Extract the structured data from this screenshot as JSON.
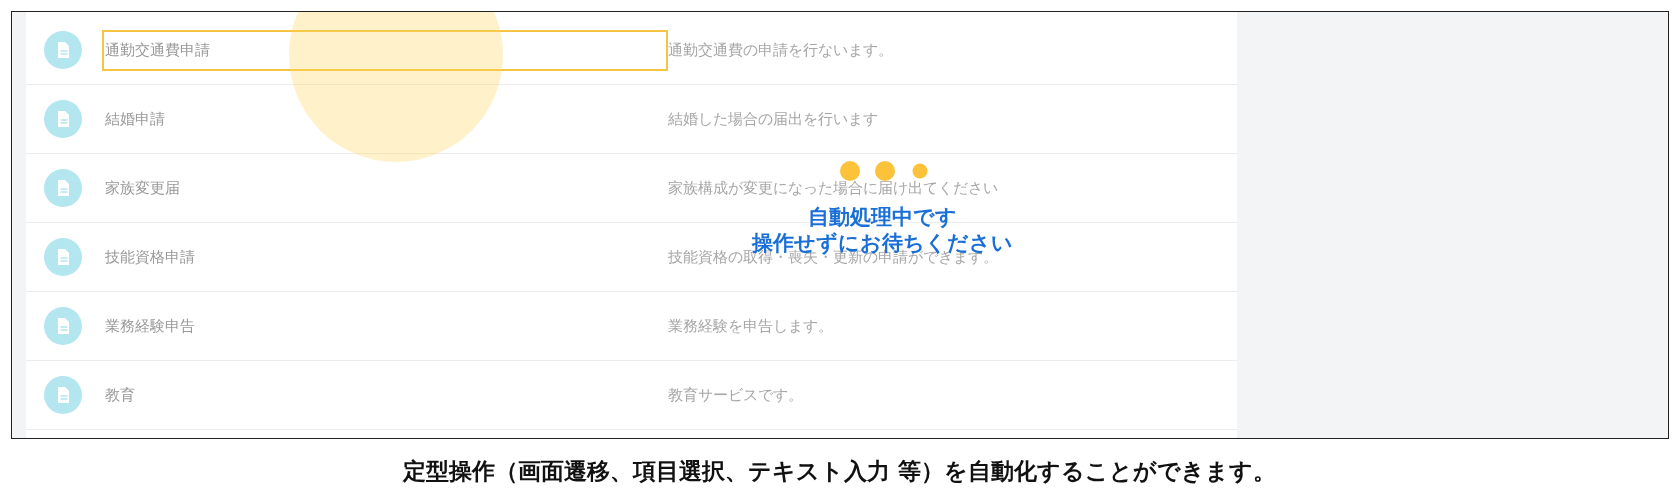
{
  "rows": [
    {
      "name": "通勤交通費申請",
      "description": "通勤交通費の申請を行ないます。",
      "selected": true
    },
    {
      "name": "結婚申請",
      "description": "結婚した場合の届出を行います",
      "selected": false
    },
    {
      "name": "家族変更届",
      "description": "家族構成が変更になった場合に届け出てください",
      "selected": false
    },
    {
      "name": "技能資格申請",
      "description": "技能資格の取得・喪失・更新の申請ができます。",
      "selected": false
    },
    {
      "name": "業務経験申告",
      "description": "業務経験を申告します。",
      "selected": false
    },
    {
      "name": "教育",
      "description": "教育サービスです。",
      "selected": false
    }
  ],
  "overlay": {
    "lines": [
      "自動処理中です",
      "操作せずにお待ちください"
    ]
  },
  "caption": "定型操作（画面遷移、項目選択、テキスト入力 等）を自動化することができます。"
}
